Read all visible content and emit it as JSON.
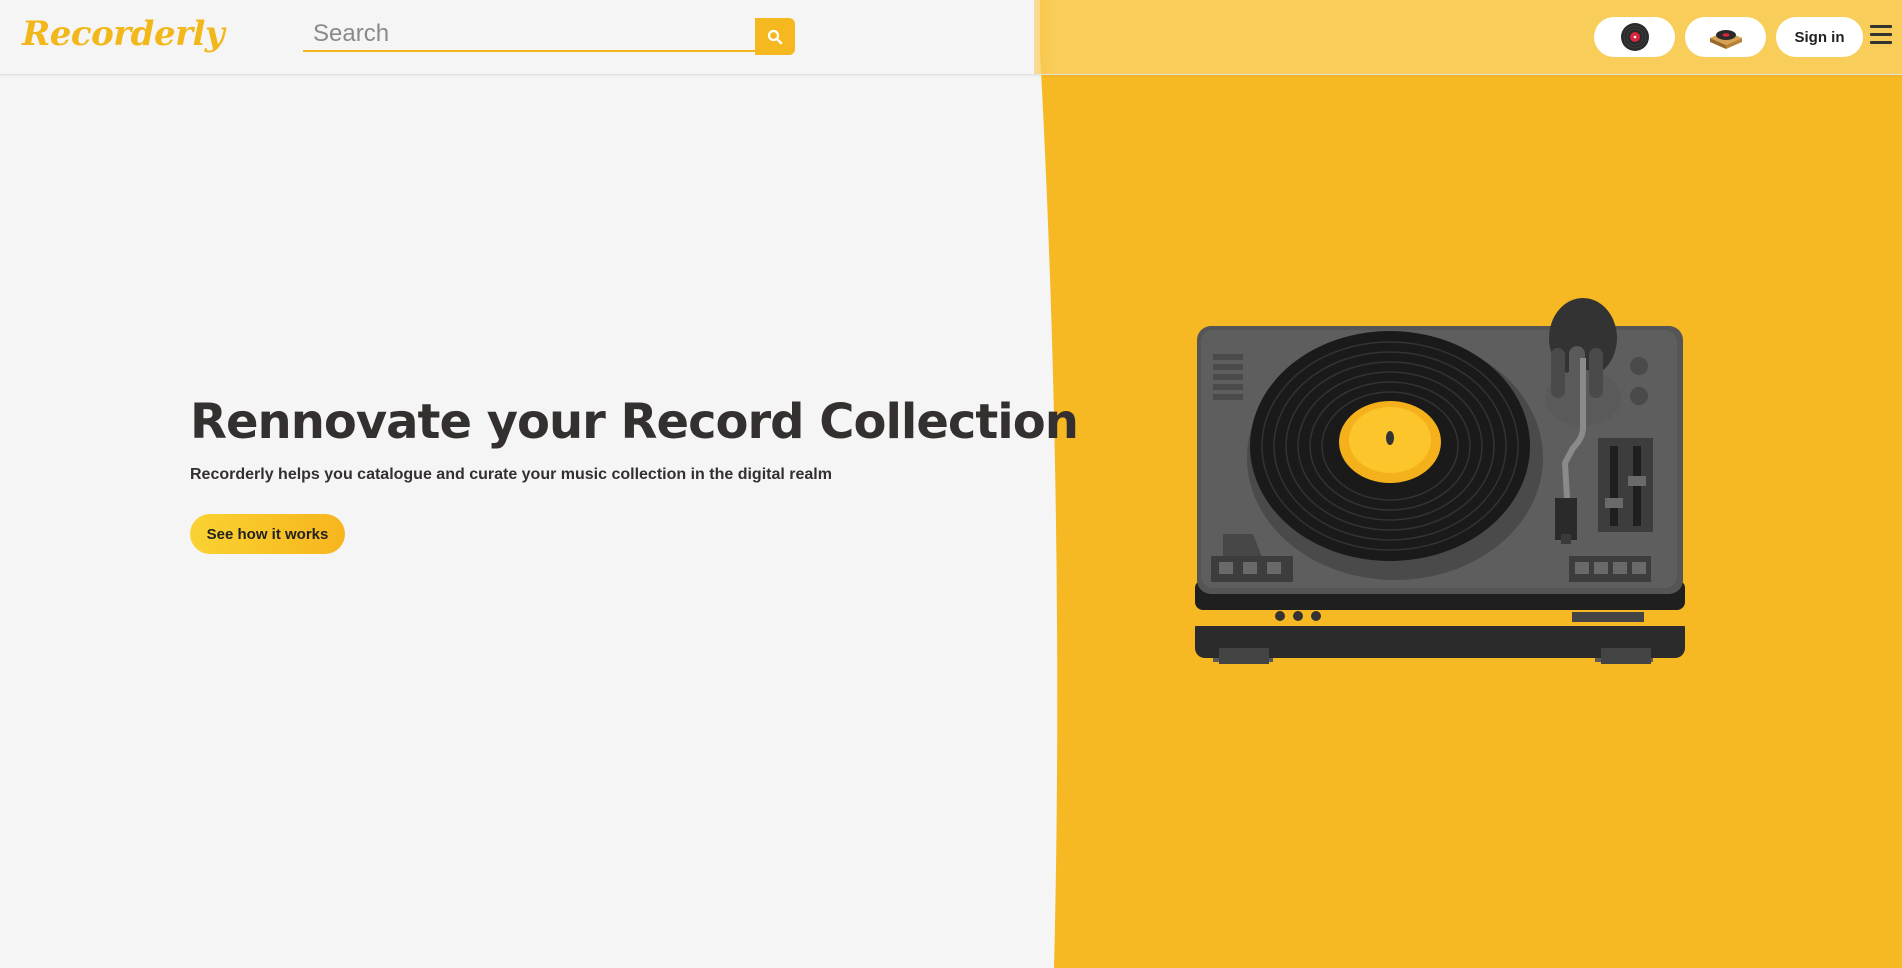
{
  "brand": {
    "name": "Recorderly",
    "color": "#f2b81b"
  },
  "search": {
    "placeholder": "Search",
    "value": "",
    "icon": "search-icon"
  },
  "nav": {
    "record_icon": "vinyl-record-icon",
    "turntable_icon": "turntable-icon",
    "signin_label": "Sign in",
    "menu_icon": "hamburger-menu-icon"
  },
  "hero": {
    "title": "Rennovate your Record Collection",
    "subtitle": "Recorderly helps you catalogue and curate your music collection in the digital realm",
    "cta_label": "See how it works"
  },
  "illustration": {
    "name": "turntable-illustration"
  },
  "colors": {
    "accent": "#f7b923",
    "background": "#f5f5f5",
    "text": "#34302f",
    "header_right": "#f9cd5a"
  }
}
